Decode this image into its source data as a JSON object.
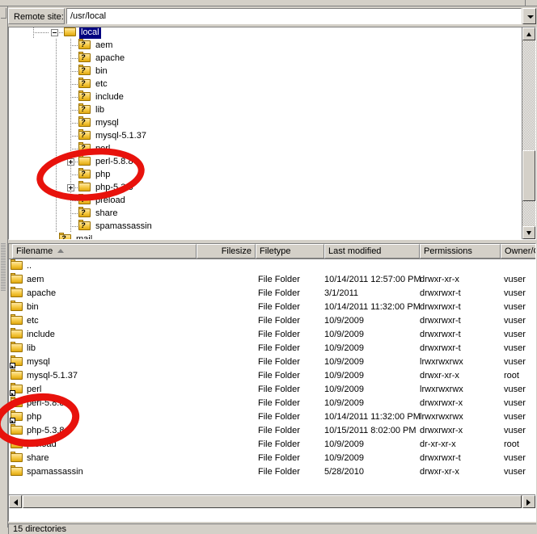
{
  "window": {
    "status_text": "15 directories"
  },
  "sitebar": {
    "label": "Remote site:",
    "path": "/usr/local",
    "dropdown_icon": "chevron-down-icon"
  },
  "tree": {
    "root": {
      "label": "local",
      "selected": true,
      "expander": "minus",
      "icon": "folder-icon"
    },
    "items": [
      {
        "label": "aem",
        "icon": "folder-unknown-icon",
        "expander": "none",
        "indent": 1
      },
      {
        "label": "apache",
        "icon": "folder-unknown-icon",
        "expander": "none",
        "indent": 1
      },
      {
        "label": "bin",
        "icon": "folder-unknown-icon",
        "expander": "none",
        "indent": 1
      },
      {
        "label": "etc",
        "icon": "folder-unknown-icon",
        "expander": "none",
        "indent": 1
      },
      {
        "label": "include",
        "icon": "folder-unknown-icon",
        "expander": "none",
        "indent": 1
      },
      {
        "label": "lib",
        "icon": "folder-unknown-icon",
        "expander": "none",
        "indent": 1
      },
      {
        "label": "mysql",
        "icon": "folder-unknown-icon",
        "expander": "none",
        "indent": 1
      },
      {
        "label": "mysql-5.1.37",
        "icon": "folder-unknown-icon",
        "expander": "none",
        "indent": 1
      },
      {
        "label": "perl",
        "icon": "folder-unknown-icon",
        "expander": "none",
        "indent": 1
      },
      {
        "label": "perl-5.8.8",
        "icon": "folder-icon",
        "expander": "plus",
        "indent": 1
      },
      {
        "label": "php",
        "icon": "folder-unknown-icon",
        "expander": "none",
        "indent": 1
      },
      {
        "label": "php-5.3.8",
        "icon": "folder-icon",
        "expander": "plus",
        "indent": 1
      },
      {
        "label": "preload",
        "icon": "folder-unknown-icon",
        "expander": "none",
        "indent": 1
      },
      {
        "label": "share",
        "icon": "folder-unknown-icon",
        "expander": "none",
        "indent": 1
      },
      {
        "label": "spamassassin",
        "icon": "folder-unknown-icon",
        "expander": "none",
        "indent": 1
      },
      {
        "label": "mail",
        "icon": "folder-unknown-icon",
        "expander": "none",
        "indent": 0
      }
    ]
  },
  "filelist": {
    "columns": [
      {
        "key": "name",
        "label": "Filename",
        "sorted": "asc"
      },
      {
        "key": "size",
        "label": "Filesize",
        "sorted": "none"
      },
      {
        "key": "type",
        "label": "Filetype",
        "sorted": "none"
      },
      {
        "key": "mod",
        "label": "Last modified",
        "sorted": "none"
      },
      {
        "key": "perm",
        "label": "Permissions",
        "sorted": "none"
      },
      {
        "key": "owner",
        "label": "Owner/Gro",
        "sorted": "none"
      }
    ],
    "rows": [
      {
        "name": "..",
        "size": "",
        "type": "",
        "mod": "",
        "perm": "",
        "owner": "",
        "icon": "folder-icon",
        "symlink": false
      },
      {
        "name": "aem",
        "size": "",
        "type": "File Folder",
        "mod": "10/14/2011 12:57:00 PM",
        "perm": "drwxr-xr-x",
        "owner": "vuser",
        "icon": "folder-icon",
        "symlink": false
      },
      {
        "name": "apache",
        "size": "",
        "type": "File Folder",
        "mod": "3/1/2011",
        "perm": "drwxrwxr-t",
        "owner": "vuser",
        "icon": "folder-icon",
        "symlink": false
      },
      {
        "name": "bin",
        "size": "",
        "type": "File Folder",
        "mod": "10/14/2011 11:32:00 PM",
        "perm": "drwxrwxr-t",
        "owner": "vuser",
        "icon": "folder-icon",
        "symlink": false
      },
      {
        "name": "etc",
        "size": "",
        "type": "File Folder",
        "mod": "10/9/2009",
        "perm": "drwxrwxr-t",
        "owner": "vuser",
        "icon": "folder-icon",
        "symlink": false
      },
      {
        "name": "include",
        "size": "",
        "type": "File Folder",
        "mod": "10/9/2009",
        "perm": "drwxrwxr-t",
        "owner": "vuser",
        "icon": "folder-icon",
        "symlink": false
      },
      {
        "name": "lib",
        "size": "",
        "type": "File Folder",
        "mod": "10/9/2009",
        "perm": "drwxrwxr-t",
        "owner": "vuser",
        "icon": "folder-icon",
        "symlink": false
      },
      {
        "name": "mysql",
        "size": "",
        "type": "File Folder",
        "mod": "10/9/2009",
        "perm": "lrwxrwxrwx",
        "owner": "vuser",
        "icon": "folder-link-icon",
        "symlink": true
      },
      {
        "name": "mysql-5.1.37",
        "size": "",
        "type": "File Folder",
        "mod": "10/9/2009",
        "perm": "drwxr-xr-x",
        "owner": "root",
        "icon": "folder-icon",
        "symlink": false
      },
      {
        "name": "perl",
        "size": "",
        "type": "File Folder",
        "mod": "10/9/2009",
        "perm": "lrwxrwxrwx",
        "owner": "vuser",
        "icon": "folder-link-icon",
        "symlink": true
      },
      {
        "name": "perl-5.8.8",
        "size": "",
        "type": "File Folder",
        "mod": "10/9/2009",
        "perm": "drwxrwxr-x",
        "owner": "vuser",
        "icon": "folder-icon",
        "symlink": false
      },
      {
        "name": "php",
        "size": "",
        "type": "File Folder",
        "mod": "10/14/2011 11:32:00 PM",
        "perm": "lrwxrwxrwx",
        "owner": "vuser",
        "icon": "folder-link-icon",
        "symlink": true
      },
      {
        "name": "php-5.3.8",
        "size": "",
        "type": "File Folder",
        "mod": "10/15/2011 8:02:00 PM",
        "perm": "drwxrwxr-x",
        "owner": "vuser",
        "icon": "folder-icon",
        "symlink": false
      },
      {
        "name": "preload",
        "size": "",
        "type": "File Folder",
        "mod": "10/9/2009",
        "perm": "dr-xr-xr-x",
        "owner": "root",
        "icon": "folder-icon",
        "symlink": false
      },
      {
        "name": "share",
        "size": "",
        "type": "File Folder",
        "mod": "10/9/2009",
        "perm": "drwxrwxr-t",
        "owner": "vuser",
        "icon": "folder-icon",
        "symlink": false
      },
      {
        "name": "spamassassin",
        "size": "",
        "type": "File Folder",
        "mod": "5/28/2010",
        "perm": "drwxr-xr-x",
        "owner": "vuser",
        "icon": "folder-icon",
        "symlink": false
      }
    ]
  },
  "annotations": {
    "color": "#e8120c",
    "ellipses": [
      {
        "name": "tree-php-highlight",
        "note": "circles perl-5.8.8 / php / php-5.3.8 / preload in tree"
      },
      {
        "name": "list-php-highlight",
        "note": "circles perl-5.8.8 / php / php-5.3.8 / preload in file list"
      }
    ]
  },
  "colors": {
    "face": "#d4d0c8",
    "selection": "#000080",
    "selection_text": "#ffffff",
    "annotation_red": "#e8120c"
  }
}
